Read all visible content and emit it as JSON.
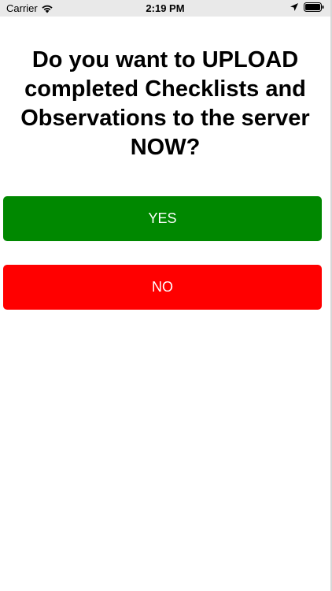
{
  "status_bar": {
    "carrier": "Carrier",
    "time": "2:19 PM",
    "icons": [
      "wifi-icon",
      "location-icon",
      "battery-icon"
    ]
  },
  "question": "Do you want to UPLOAD completed Checklists and Observations to the server NOW?",
  "buttons": {
    "yes": {
      "label": "YES",
      "color": "#008800"
    },
    "no": {
      "label": "NO",
      "color": "#ff0000"
    }
  }
}
